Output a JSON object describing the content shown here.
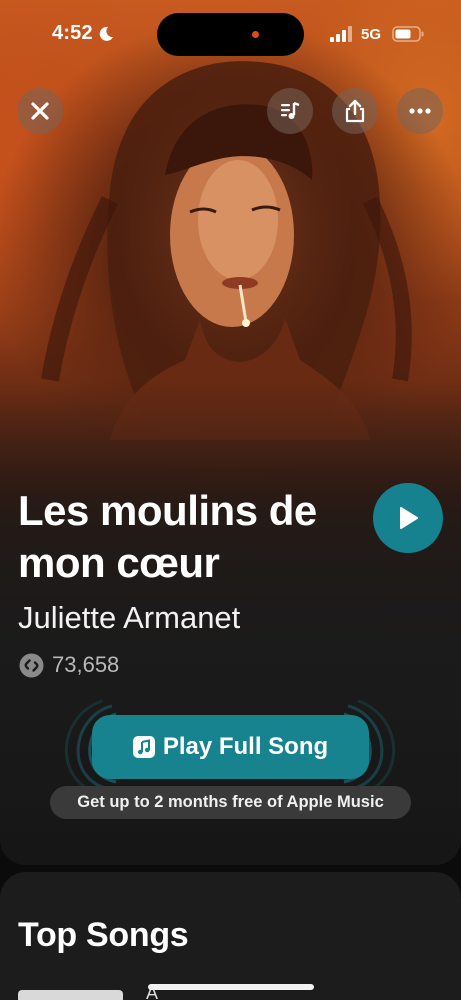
{
  "status_bar": {
    "time": "4:52",
    "network": "5G",
    "icons": [
      "moon-icon",
      "signal-icon",
      "battery-icon"
    ]
  },
  "top_actions": {
    "close_icon": "close-icon",
    "lyrics_icon": "lyrics-icon",
    "share_icon": "share-icon",
    "more_icon": "more-icon"
  },
  "song": {
    "title": "Les moulins de mon cœur",
    "artist": "Juliette Armanet",
    "shazam_count": "73,658"
  },
  "actions": {
    "play_full_label": "Play Full Song",
    "offer_label": "Get up to 2 months free of Apple Music"
  },
  "top_songs": {
    "title": "Top Songs",
    "first_item_peek": "À"
  },
  "colors": {
    "accent": "#17828F",
    "offer_pill": "#3A3A3A",
    "card": "#1C1C1C"
  }
}
